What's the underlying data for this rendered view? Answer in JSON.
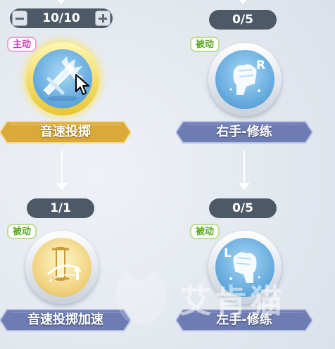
{
  "skills": {
    "sonic_throw": {
      "counter": "10/10",
      "tag": "主动",
      "name": "音速投掷",
      "level_fraction": 1.0
    },
    "right_hand": {
      "counter": "0/5",
      "tag": "被动",
      "name": "右手-修练",
      "icon_letter": "R",
      "level_fraction": 0.0
    },
    "sonic_accel": {
      "counter": "1/1",
      "tag": "被动",
      "name": "音速投掷加速",
      "level_fraction": 1.0
    },
    "left_hand": {
      "counter": "0/5",
      "tag": "被动",
      "name": "左手-修练",
      "icon_letter": "L",
      "level_fraction": 0.0
    }
  },
  "watermark": {
    "text": "艾肯猫"
  },
  "colors": {
    "gold_banner": "#d9a93a",
    "blue_banner": "#6d7cb2",
    "counter_bg": "#4e5967",
    "active_tag": "#cc3fb6",
    "passive_tag": "#57a81e"
  },
  "icons": {
    "decrement": "minus-icon",
    "increment": "plus-icon",
    "sonic_throw": "crossbow-icon",
    "right_hand": "fist-icon",
    "sonic_accel": "speed-arrow-icon",
    "left_hand": "fist-icon"
  }
}
